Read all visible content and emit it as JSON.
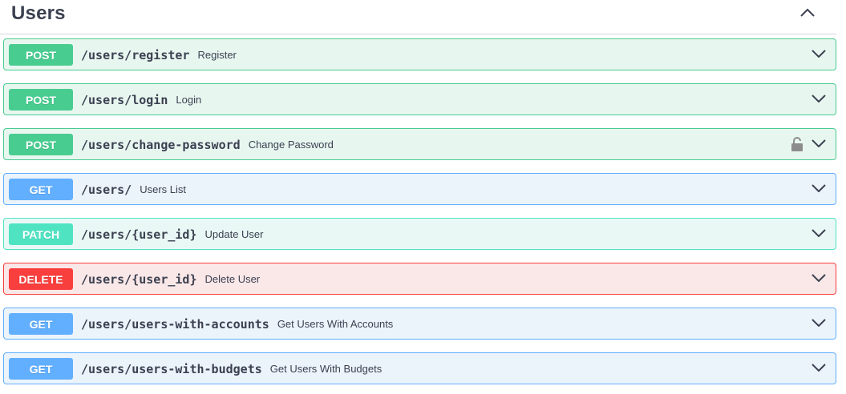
{
  "tag": {
    "title": "Users",
    "collapse_icon": "chevron-up-icon"
  },
  "operations": [
    {
      "method": "POST",
      "path": "/users/register",
      "summary": "Register",
      "locked": false
    },
    {
      "method": "POST",
      "path": "/users/login",
      "summary": "Login",
      "locked": false
    },
    {
      "method": "POST",
      "path": "/users/change-password",
      "summary": "Change Password",
      "locked": true
    },
    {
      "method": "GET",
      "path": "/users/",
      "summary": "Users List",
      "locked": false
    },
    {
      "method": "PATCH",
      "path": "/users/{user_id}",
      "summary": "Update User",
      "locked": false
    },
    {
      "method": "DELETE",
      "path": "/users/{user_id}",
      "summary": "Delete User",
      "locked": false
    },
    {
      "method": "GET",
      "path": "/users/users-with-accounts",
      "summary": "Get Users With Accounts",
      "locked": false
    },
    {
      "method": "GET",
      "path": "/users/users-with-budgets",
      "summary": "Get Users With Budgets",
      "locked": false
    }
  ],
  "colors": {
    "post": "#49cc90",
    "get": "#61affe",
    "patch": "#50e3c2",
    "delete": "#f93e3e",
    "text": "#3b4151"
  }
}
